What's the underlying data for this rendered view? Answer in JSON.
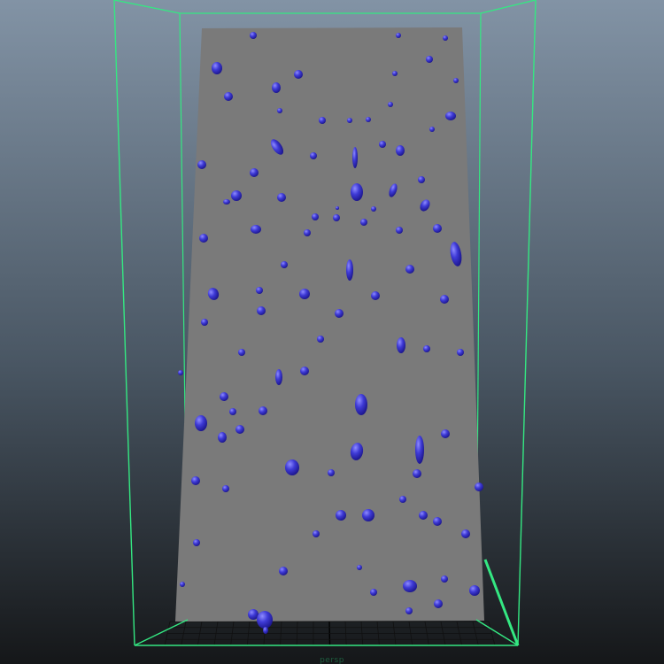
{
  "viewport": {
    "camera_label": "persp",
    "colors": {
      "background_top": "#8293a5",
      "background_mid": "#495663",
      "background_bottom": "#151719",
      "glass_wall": "#7a7a7a",
      "bounding_box": "#34e882",
      "ground_grid": "#111111",
      "ground_grid_axis": "#000000",
      "particle": "#3e3ad6",
      "particle_highlight": "#8e8bff",
      "particle_shadow": "#1a1488",
      "camera_label": "#1f6a46"
    },
    "icons": {
      "particles": "water-droplet-icon"
    }
  }
}
